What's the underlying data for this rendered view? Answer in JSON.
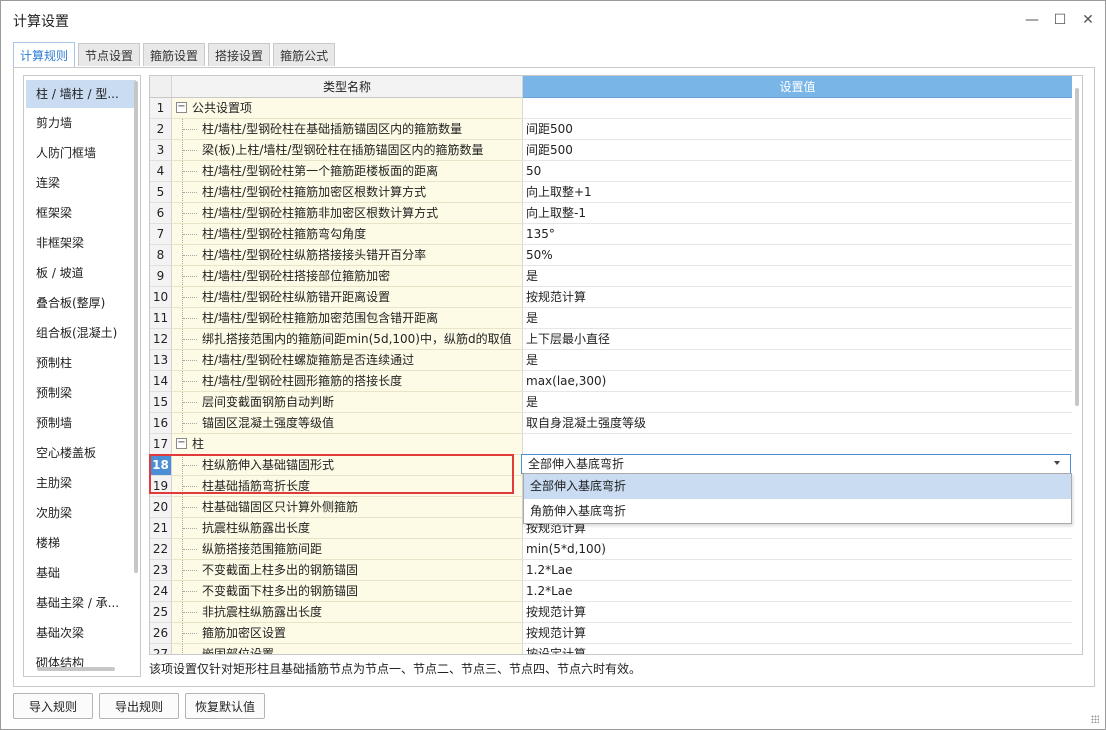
{
  "window": {
    "title": "计算设置"
  },
  "tabs": [
    "计算规则",
    "节点设置",
    "箍筋设置",
    "搭接设置",
    "箍筋公式"
  ],
  "sidebar": {
    "items": [
      "柱 / 墙柱 / 型...",
      "剪力墙",
      "人防门框墙",
      "连梁",
      "框架梁",
      "非框架梁",
      "板 / 坡道",
      "叠合板(整厚)",
      "组合板(混凝土)",
      "预制柱",
      "预制梁",
      "预制墙",
      "空心楼盖板",
      "主肋梁",
      "次肋梁",
      "楼梯",
      "基础",
      "基础主梁 / 承...",
      "基础次梁",
      "砌体结构"
    ]
  },
  "grid": {
    "headers": {
      "name": "类型名称",
      "value": "设置值"
    },
    "rows": [
      {
        "num": "1",
        "name": "公共设置项",
        "value": ""
      },
      {
        "num": "2",
        "name": "柱/墙柱/型钢砼柱在基础插筋锚固区内的箍筋数量",
        "value": "间距500"
      },
      {
        "num": "3",
        "name": "梁(板)上柱/墙柱/型钢砼柱在插筋锚固区内的箍筋数量",
        "value": "间距500"
      },
      {
        "num": "4",
        "name": "柱/墙柱/型钢砼柱第一个箍筋距楼板面的距离",
        "value": "50"
      },
      {
        "num": "5",
        "name": "柱/墙柱/型钢砼柱箍筋加密区根数计算方式",
        "value": "向上取整+1"
      },
      {
        "num": "6",
        "name": "柱/墙柱/型钢砼柱箍筋非加密区根数计算方式",
        "value": "向上取整-1"
      },
      {
        "num": "7",
        "name": "柱/墙柱/型钢砼柱箍筋弯勾角度",
        "value": "135°"
      },
      {
        "num": "8",
        "name": "柱/墙柱/型钢砼柱纵筋搭接接头错开百分率",
        "value": "50%"
      },
      {
        "num": "9",
        "name": "柱/墙柱/型钢砼柱搭接部位箍筋加密",
        "value": "是"
      },
      {
        "num": "10",
        "name": "柱/墙柱/型钢砼柱纵筋错开距离设置",
        "value": "按规范计算"
      },
      {
        "num": "11",
        "name": "柱/墙柱/型钢砼柱箍筋加密范围包含错开距离",
        "value": "是"
      },
      {
        "num": "12",
        "name": "绑扎搭接范围内的箍筋间距min(5d,100)中，纵筋d的取值",
        "value": "上下层最小直径"
      },
      {
        "num": "13",
        "name": "柱/墙柱/型钢砼柱螺旋箍筋是否连续通过",
        "value": "是"
      },
      {
        "num": "14",
        "name": "柱/墙柱/型钢砼柱圆形箍筋的搭接长度",
        "value": "max(lae,300)"
      },
      {
        "num": "15",
        "name": "层间变截面钢筋自动判断",
        "value": "是"
      },
      {
        "num": "16",
        "name": "锚固区混凝土强度等级值",
        "value": "取自身混凝土强度等级"
      },
      {
        "num": "17",
        "name": "柱",
        "value": ""
      },
      {
        "num": "18",
        "name": "柱纵筋伸入基础锚固形式",
        "value": "全部伸入基底弯折"
      },
      {
        "num": "19",
        "name": "柱基础插筋弯折长度",
        "value": ""
      },
      {
        "num": "20",
        "name": "柱基础锚固区只计算外侧箍筋",
        "value": ""
      },
      {
        "num": "21",
        "name": "抗震柱纵筋露出长度",
        "value": "按规范计算"
      },
      {
        "num": "22",
        "name": "纵筋搭接范围箍筋间距",
        "value": "min(5*d,100)"
      },
      {
        "num": "23",
        "name": "不变截面上柱多出的钢筋锚固",
        "value": "1.2*Lae"
      },
      {
        "num": "24",
        "name": "不变截面下柱多出的钢筋锚固",
        "value": "1.2*Lae"
      },
      {
        "num": "25",
        "name": "非抗震柱纵筋露出长度",
        "value": "按规范计算"
      },
      {
        "num": "26",
        "name": "箍筋加密区设置",
        "value": "按规范计算"
      },
      {
        "num": "27",
        "name": "嵌固部位设置",
        "value": "按设定计算"
      }
    ]
  },
  "dropdown": {
    "selected": "全部伸入基底弯折",
    "options": [
      "全部伸入基底弯折",
      "角筋伸入基底弯折"
    ]
  },
  "footer": {
    "note": "该项设置仅针对矩形柱且基础插筋节点为节点一、节点二、节点三、节点四、节点六时有效。",
    "buttons": [
      "导入规则",
      "导出规则",
      "恢复默认值"
    ]
  }
}
